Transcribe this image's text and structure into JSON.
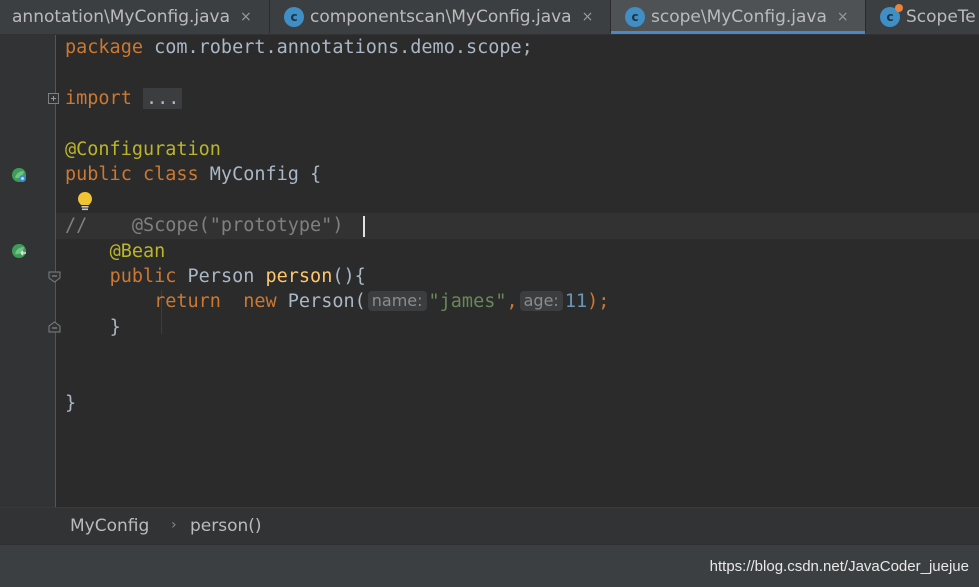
{
  "tabs": [
    {
      "label": "annotation\\MyConfig.java",
      "close": "×"
    },
    {
      "label": "componentscan\\MyConfig.java",
      "close": "×"
    },
    {
      "label": "scope\\MyConfig.java",
      "close": "×",
      "active": true
    },
    {
      "label": "ScopeTe"
    }
  ],
  "class_icon_letter": "c",
  "code": {
    "package_kw": "package",
    "package_name": " com.robert.annotations.demo.scope;",
    "import_kw": "import",
    "import_folded": "...",
    "configuration_ann": "@Configuration",
    "class_decl_kw": "public class",
    "class_name": " MyConfig {",
    "comment_marker": "//",
    "scope_ann": "    @Scope(\"prototype\")",
    "bean_ann": "@Bean",
    "method_kw": "public",
    "method_type": " Person ",
    "method_name": "person",
    "method_tail": "(){",
    "return_kw": "return",
    "new_kw": "new",
    "new_type": " Person(",
    "hint_name": "name:",
    "arg_string": "\"james\"",
    "comma": ",",
    "hint_age": "age:",
    "arg_number": "11",
    "closing": ");",
    "brace_method": "}",
    "brace_class": "}"
  },
  "breadcrumb": {
    "class": "MyConfig",
    "method": "person()",
    "separator": "›"
  },
  "watermark": "https://blog.csdn.net/JavaCoder_juejue",
  "colors": {
    "keyword": "#cc7832",
    "annotation": "#bbb529",
    "string": "#6a8759",
    "number": "#6897bb",
    "method": "#ffc66d",
    "comment": "#808080",
    "accent": "#4a88c7"
  }
}
